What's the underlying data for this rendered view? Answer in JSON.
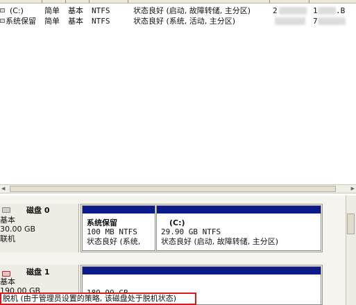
{
  "volume_list": {
    "rows": [
      {
        "volume": "(C:)",
        "layout": "简单",
        "type": "基本",
        "file_system": "NTFS",
        "status": "状态良好 (启动, 故障转储, 主分区)",
        "capacity_start": "2",
        "free_end": ".B",
        "free_start": "1"
      },
      {
        "volume": "系统保留",
        "layout": "简单",
        "type": "基本",
        "file_system": "NTFS",
        "status": "状态良好 (系统, 活动, 主分区)",
        "capacity_start": "",
        "free_end": "",
        "free_start": "7"
      }
    ]
  },
  "disks": [
    {
      "name": "磁盘 0",
      "type": "基本",
      "size": "30.00 GB",
      "state": "联机",
      "partitions": [
        {
          "name": "系统保留",
          "size": "100 MB NTFS",
          "status": "状态良好 (系统,"
        },
        {
          "name": "(C:)",
          "size": "29.90 GB NTFS",
          "status": "状态良好 (启动, 故障转储, 主分区)"
        }
      ]
    },
    {
      "name": "磁盘 1",
      "type": "基本",
      "size": "190.00 GB",
      "state": "脱机",
      "partitions": [
        {
          "size": "189.99 GB"
        }
      ],
      "offline_message": "脱机 (由于管理员设置的策略, 该磁盘处于脱机状态)"
    }
  ],
  "colors": {
    "primary_partition_bar": "#0c1a8a",
    "highlight_border": "#d51a1a"
  }
}
